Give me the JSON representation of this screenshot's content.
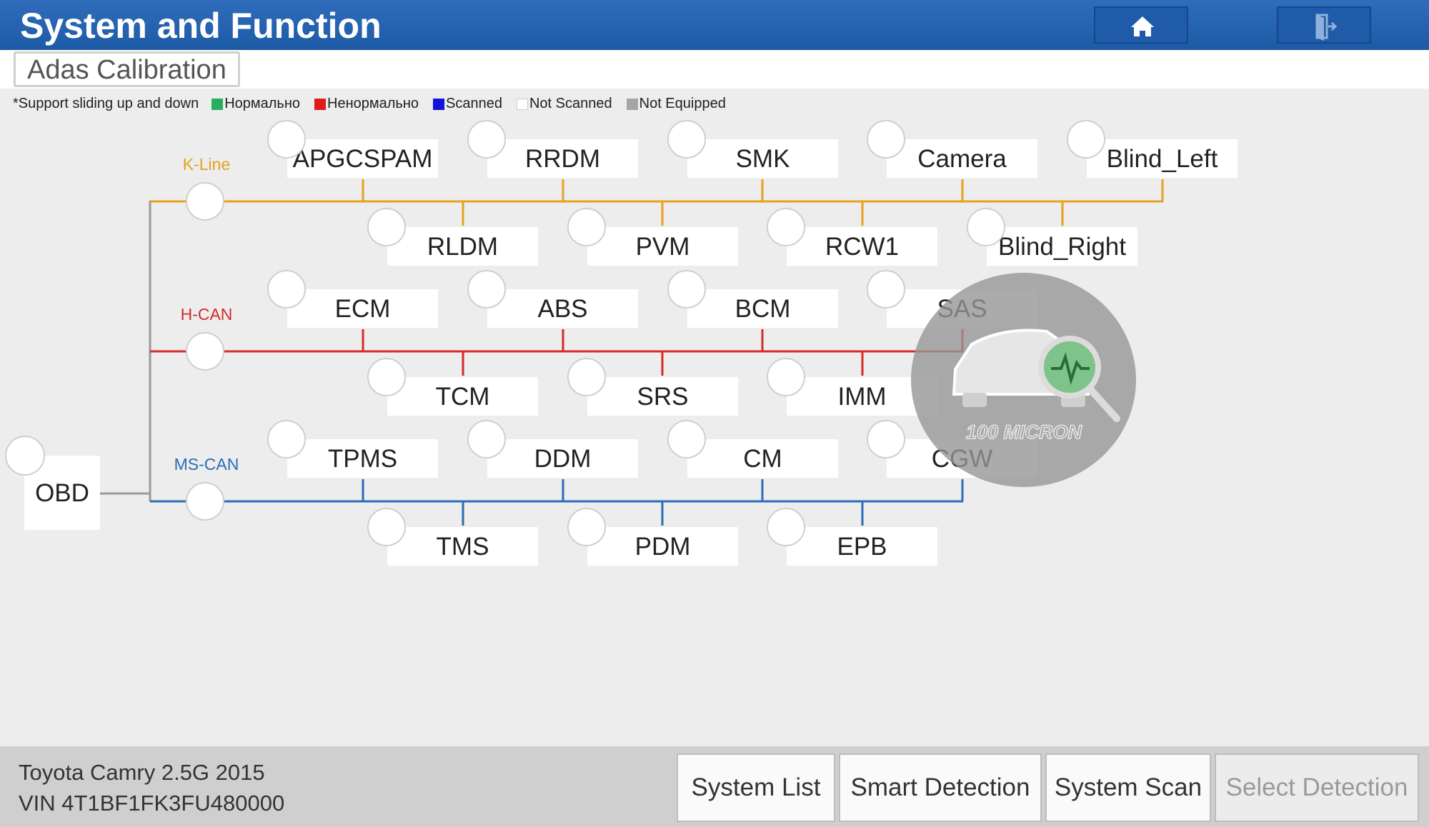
{
  "header": {
    "title": "System and Function"
  },
  "tab": {
    "label": "Adas Calibration"
  },
  "legend": {
    "note": "*Support sliding up and down",
    "items": [
      {
        "label": "Нормально",
        "color": "#27ae60"
      },
      {
        "label": "Ненормально",
        "color": "#e01b1b"
      },
      {
        "label": "Scanned",
        "color": "#1414d8"
      },
      {
        "label": "Not Scanned",
        "color": "#ffffff"
      },
      {
        "label": "Not Equipped",
        "color": "#a5a5a5"
      }
    ]
  },
  "buses": {
    "kline": {
      "label": "K-Line",
      "color": "#e8a020"
    },
    "hcan": {
      "label": "H-CAN",
      "color": "#d42b2b"
    },
    "mscan": {
      "label": "MS-CAN",
      "color": "#2a6db5"
    }
  },
  "obd": {
    "label": "OBD"
  },
  "modules": {
    "kline_top": [
      "APGCSPAM",
      "RRDM",
      "SMK",
      "Camera",
      "Blind_Left"
    ],
    "kline_bottom": [
      "RLDM",
      "PVM",
      "RCW1",
      "Blind_Right"
    ],
    "hcan_top": [
      "ECM",
      "ABS",
      "BCM",
      "SAS"
    ],
    "hcan_bottom": [
      "TCM",
      "SRS",
      "IMM"
    ],
    "mscan_top": [
      "TPMS",
      "DDM",
      "CM",
      "CGW"
    ],
    "mscan_bottom": [
      "TMS",
      "PDM",
      "EPB"
    ]
  },
  "watermark": {
    "text": "100 MICRON",
    "icon": "car-scan-logo-icon"
  },
  "footer": {
    "vehicle": "Toyota Camry 2.5G 2015",
    "vin": "VIN 4T1BF1FK3FU480000",
    "buttons": {
      "system_list": "System List",
      "smart_detection": "Smart Detection",
      "system_scan": "System Scan",
      "select_detection": "Select Detection"
    }
  },
  "icons": {
    "home": "home-icon",
    "exit": "exit-icon"
  }
}
